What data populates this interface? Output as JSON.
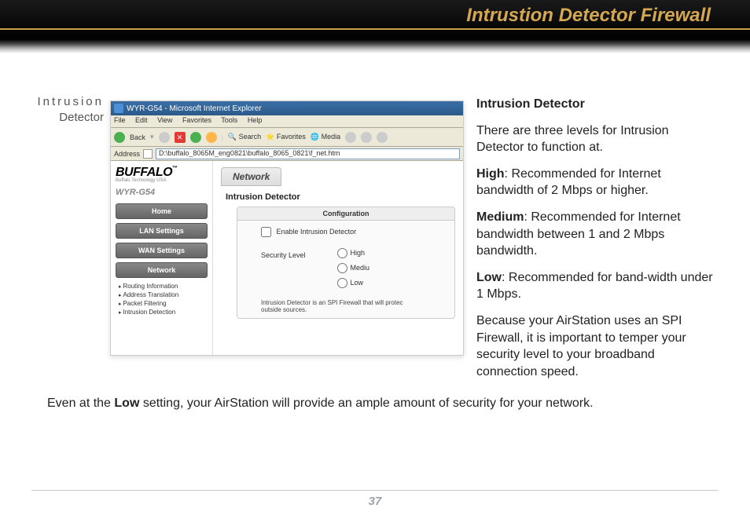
{
  "header": {
    "title": "Intrustion Detector Firewall"
  },
  "leftLabel": {
    "row1": "Intrusion",
    "row2": "Detector"
  },
  "screenshot": {
    "windowTitle": "WYR-G54 - Microsoft Internet Explorer",
    "menu": {
      "file": "File",
      "edit": "Edit",
      "view": "View",
      "favorites": "Favorites",
      "tools": "Tools",
      "help": "Help"
    },
    "toolbar": {
      "back": "Back",
      "search": "Search",
      "favorites": "Favorites",
      "media": "Media"
    },
    "address": {
      "label": "Address",
      "url": "D:\\buffalo_8065M_eng0821\\buffalo_8065_0821\\f_net.htm"
    },
    "brand": "BUFFALO",
    "brandSub": "Buffalo Technology USA",
    "model": "WYR-G54",
    "nav": {
      "home": "Home",
      "lan": "LAN Settings",
      "wan": "WAN Settings",
      "network": "Network"
    },
    "sub": {
      "routing": "Routing Information",
      "address": "Address Translation",
      "packet": "Packet Filtering",
      "intrusion": "Intrusion Detection"
    },
    "tab": "Network",
    "panelTitle": "Intrusion Detector",
    "config": {
      "header": "Configuration",
      "enable": "Enable Intrusion Detector",
      "securityLabel": "Security Level",
      "high": "High",
      "medium": "Mediu",
      "low": "Low",
      "desc": "Intrusion Detector is an SPI Firewall that will protec",
      "desc2": "outside sources."
    }
  },
  "right": {
    "heading": "Intrusion Detector",
    "p1": "There are three levels for Intrusion Detector to function at.",
    "high_l": "High",
    "high_t": ": Recommended for Internet bandwidth of 2 Mbps or higher.",
    "med_l": "Medium",
    "med_t": ": Recommended for Internet bandwidth between 1 and 2 Mbps bandwidth.",
    "low_l": "Low",
    "low_t": ": Recommended for band-width under 1 Mbps.",
    "p5": "Because your AirStation uses an SPI Firewall, it is important to temper your security level to your broadband connection speed."
  },
  "bottom": {
    "pre": "Even at the ",
    "bold": "Low",
    "post": " setting, your AirStation will provide an ample amount of security for your network."
  },
  "pageNumber": "37"
}
